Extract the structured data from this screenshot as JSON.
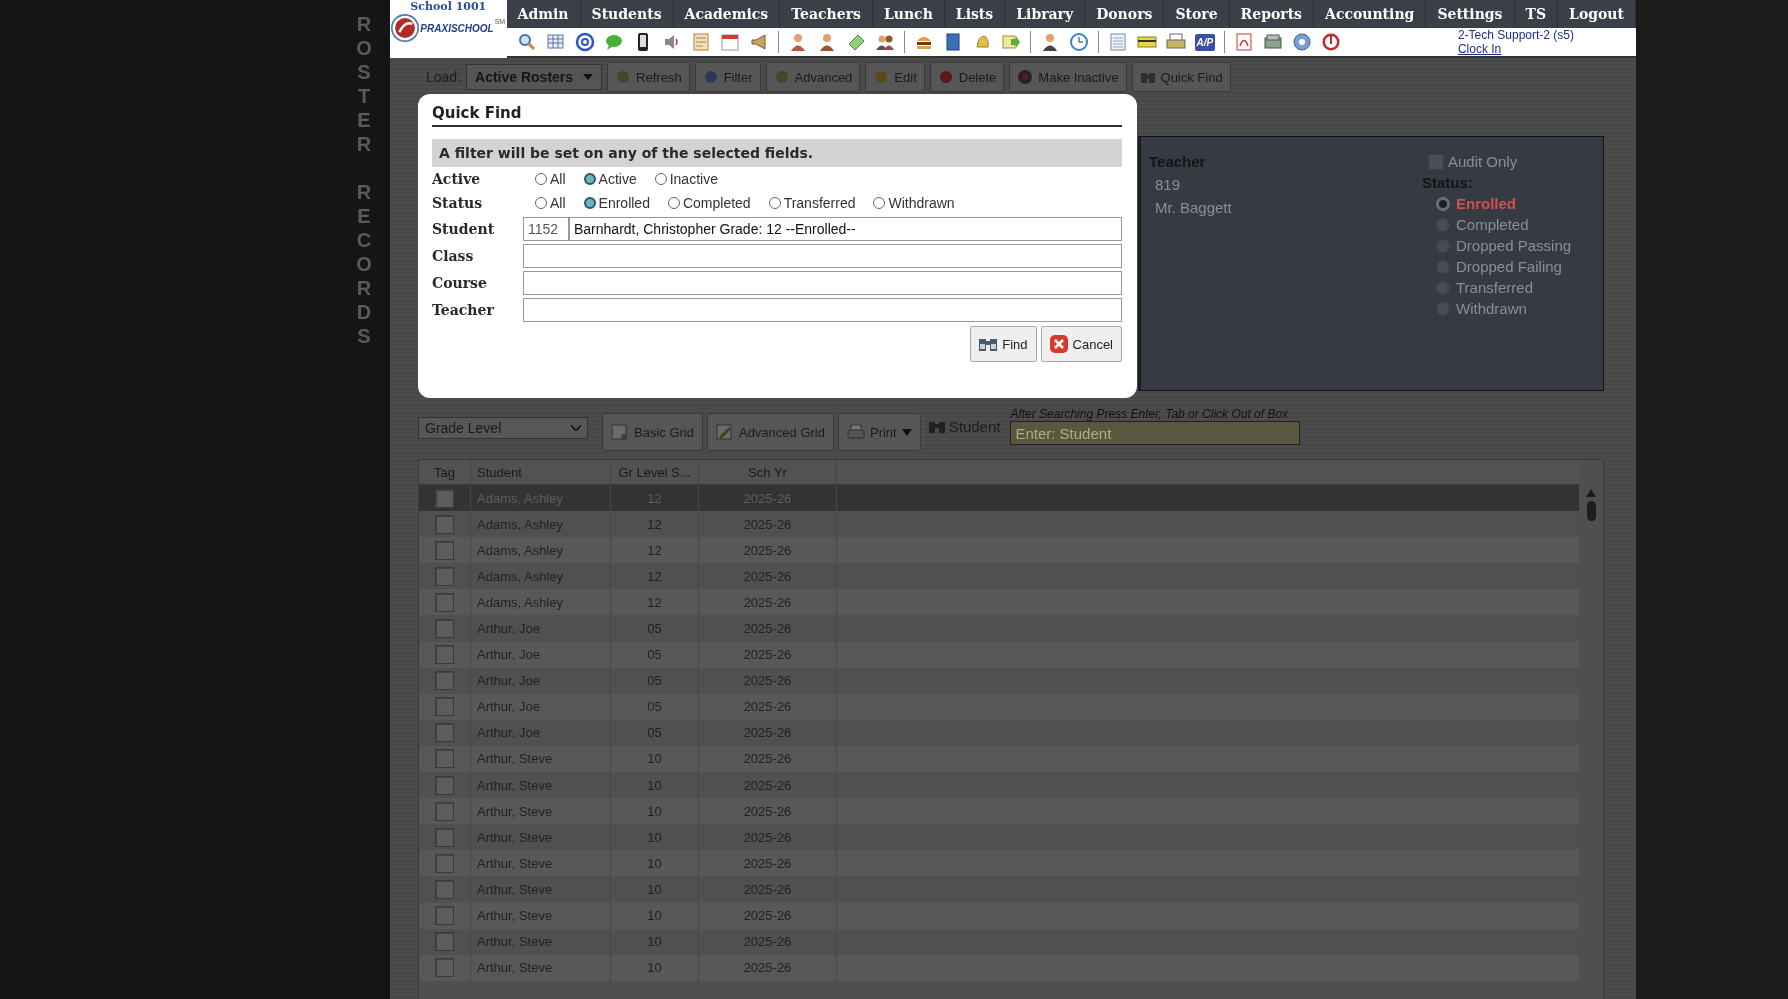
{
  "side_title_words": [
    "ROSTER",
    "RECORDS"
  ],
  "logo": {
    "school": "School 1001",
    "brand": "PRAXISCHOOL",
    "mark": "SM"
  },
  "menu": [
    "Admin",
    "Students",
    "Academics",
    "Teachers",
    "Lunch",
    "Lists",
    "Library",
    "Donors",
    "Store",
    "Reports",
    "Accounting",
    "Settings",
    "TS",
    "Logout"
  ],
  "toolbar": {
    "ap_label": "A/P"
  },
  "user": {
    "name": "2-Tech Support-2 (s5)",
    "link": "Clock In"
  },
  "action_bar": {
    "load_label": "Load:",
    "roster_select": "Active Rosters",
    "buttons": [
      "Refresh",
      "Filter",
      "Advanced",
      "Edit",
      "Delete",
      "Make Inactive",
      "Quick Find"
    ]
  },
  "detail": {
    "heading": "Teacher",
    "number": "819",
    "teacher": "Mr. Baggett",
    "audit": {
      "label": "Audit Only",
      "checked": false
    },
    "status_label": "Status:",
    "statuses": [
      {
        "label": "Enrolled",
        "selected": true
      },
      {
        "label": "Completed",
        "selected": false
      },
      {
        "label": "Dropped Passing",
        "selected": false
      },
      {
        "label": "Dropped Failing",
        "selected": false
      },
      {
        "label": "Transferred",
        "selected": false
      },
      {
        "label": "Withdrawn",
        "selected": false
      }
    ]
  },
  "grid_bar": {
    "grouping": "Grade Level",
    "buttons": [
      "Basic Grid",
      "Advanced Grid",
      "Print"
    ],
    "student_label": "Student",
    "hint": "After Searching Press Enter, Tab or Click Out of Box",
    "placeholder": "Enter: Student"
  },
  "grid": {
    "columns": [
      "Tag",
      "Student",
      "Gr Level S...",
      "Sch Yr"
    ],
    "rows": [
      {
        "tagged": false,
        "selected": true,
        "student": "Adams, Ashley",
        "grade": "12",
        "year": "2025-26"
      },
      {
        "tagged": false,
        "selected": false,
        "student": "Adams, Ashley",
        "grade": "12",
        "year": "2025-26"
      },
      {
        "tagged": false,
        "selected": false,
        "student": "Adams, Ashley",
        "grade": "12",
        "year": "2025-26"
      },
      {
        "tagged": false,
        "selected": false,
        "student": "Adams, Ashley",
        "grade": "12",
        "year": "2025-26"
      },
      {
        "tagged": false,
        "selected": false,
        "student": "Adams, Ashley",
        "grade": "12",
        "year": "2025-26"
      },
      {
        "tagged": false,
        "selected": false,
        "student": "Arthur, Joe",
        "grade": "05",
        "year": "2025-26"
      },
      {
        "tagged": false,
        "selected": false,
        "student": "Arthur, Joe",
        "grade": "05",
        "year": "2025-26"
      },
      {
        "tagged": false,
        "selected": false,
        "student": "Arthur, Joe",
        "grade": "05",
        "year": "2025-26"
      },
      {
        "tagged": false,
        "selected": false,
        "student": "Arthur, Joe",
        "grade": "05",
        "year": "2025-26"
      },
      {
        "tagged": false,
        "selected": false,
        "student": "Arthur, Joe",
        "grade": "05",
        "year": "2025-26"
      },
      {
        "tagged": false,
        "selected": false,
        "student": "Arthur, Steve",
        "grade": "10",
        "year": "2025-26"
      },
      {
        "tagged": false,
        "selected": false,
        "student": "Arthur, Steve",
        "grade": "10",
        "year": "2025-26"
      },
      {
        "tagged": false,
        "selected": false,
        "student": "Arthur, Steve",
        "grade": "10",
        "year": "2025-26"
      },
      {
        "tagged": false,
        "selected": false,
        "student": "Arthur, Steve",
        "grade": "10",
        "year": "2025-26"
      },
      {
        "tagged": false,
        "selected": false,
        "student": "Arthur, Steve",
        "grade": "10",
        "year": "2025-26"
      },
      {
        "tagged": false,
        "selected": false,
        "student": "Arthur, Steve",
        "grade": "10",
        "year": "2025-26"
      },
      {
        "tagged": false,
        "selected": false,
        "student": "Arthur, Steve",
        "grade": "10",
        "year": "2025-26"
      },
      {
        "tagged": false,
        "selected": false,
        "student": "Arthur, Steve",
        "grade": "10",
        "year": "2025-26"
      },
      {
        "tagged": false,
        "selected": false,
        "student": "Arthur, Steve",
        "grade": "10",
        "year": "2025-26"
      }
    ]
  },
  "dialog": {
    "title": "Quick Find",
    "notice": "A filter will be set on any of the selected fields.",
    "radio_groups": [
      {
        "label": "Active",
        "options": [
          {
            "label": "All",
            "selected": false
          },
          {
            "label": "Active",
            "selected": true
          },
          {
            "label": "Inactive",
            "selected": false
          }
        ]
      },
      {
        "label": "Status",
        "options": [
          {
            "label": "All",
            "selected": false
          },
          {
            "label": "Enrolled",
            "selected": true
          },
          {
            "label": "Completed",
            "selected": false
          },
          {
            "label": "Transferred",
            "selected": false
          },
          {
            "label": "Withdrawn",
            "selected": false
          }
        ]
      }
    ],
    "fields": [
      {
        "label": "Student",
        "id": "1152",
        "value": "Barnhardt, Christopher Grade: 12 --Enrolled--"
      },
      {
        "label": "Class"
      },
      {
        "label": "Course"
      },
      {
        "label": "Teacher"
      }
    ],
    "buttons": [
      {
        "kind": "find",
        "label": "Find"
      },
      {
        "kind": "cancel",
        "label": "Cancel"
      }
    ]
  }
}
